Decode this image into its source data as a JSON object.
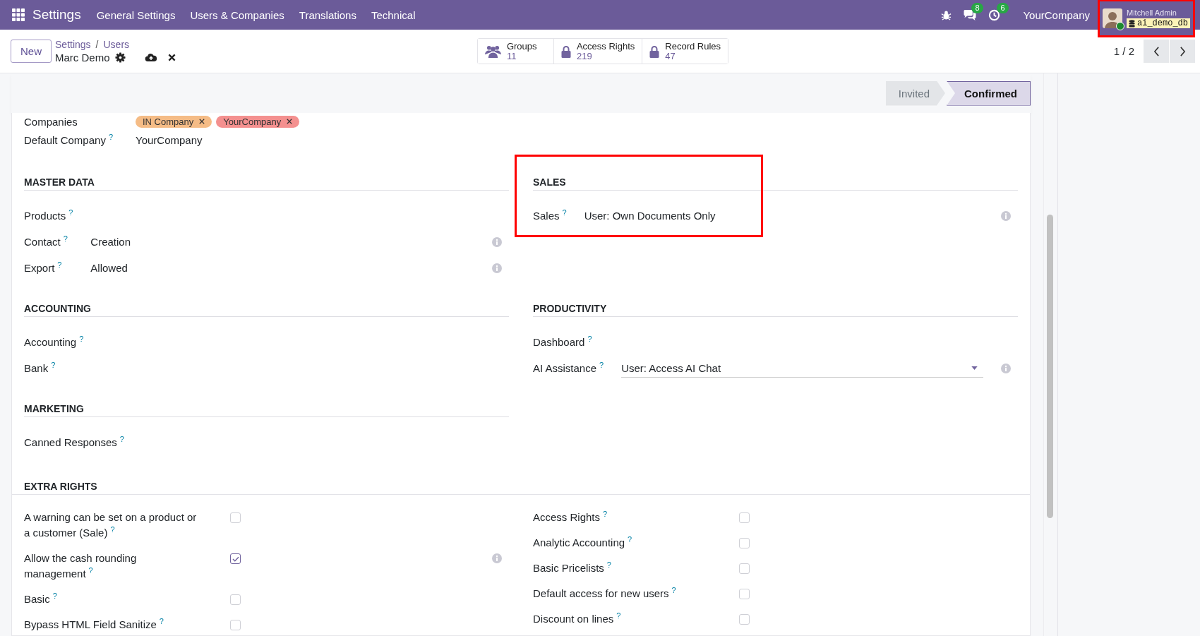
{
  "navbar": {
    "app_title": "Settings",
    "menu": [
      "General Settings",
      "Users & Companies",
      "Translations",
      "Technical"
    ],
    "messages_count": "8",
    "activities_count": "6",
    "company": "YourCompany",
    "user": {
      "name": "Mitchell Admin",
      "database": "ai_demo_db",
      "highlighted": true
    }
  },
  "control_panel": {
    "new_button": "New",
    "breadcrumbs": [
      "Settings",
      "Users"
    ],
    "breadcrumb_separator": "/",
    "record_title": "Marc Demo",
    "pager": "1 / 2",
    "smart_buttons": [
      {
        "kind": "groups",
        "label": "Groups",
        "count": "11"
      },
      {
        "kind": "lock",
        "label": "Access Rights",
        "count": "219"
      },
      {
        "kind": "lock",
        "label": "Record Rules",
        "count": "47"
      }
    ]
  },
  "status_bar": {
    "stages": [
      {
        "label": "Invited",
        "selected": false
      },
      {
        "label": "Confirmed",
        "selected": true
      }
    ]
  },
  "companies": {
    "label": "Companies",
    "tags": [
      {
        "label": "IN Company",
        "color": "#f5bc86"
      },
      {
        "label": "YourCompany",
        "color": "#f4908f"
      }
    ]
  },
  "default_company": {
    "label": "Default Company",
    "help": "?",
    "value": "YourCompany"
  },
  "section_rows": [
    [
      {
        "title": "MASTER DATA",
        "highlighted": false,
        "fields": [
          {
            "label": "Products",
            "help": "?",
            "kind": "empty",
            "info": false
          },
          {
            "label": "Contact",
            "help": "?",
            "kind": "text",
            "value": "Creation",
            "info": true
          },
          {
            "label": "Export",
            "help": "?",
            "kind": "text",
            "value": "Allowed",
            "info": true
          }
        ]
      },
      {
        "title": "SALES",
        "highlighted": true,
        "fields": [
          {
            "label": "Sales",
            "help": "?",
            "kind": "text",
            "value": "User: Own Documents Only",
            "info": true
          }
        ]
      }
    ],
    [
      {
        "title": "ACCOUNTING",
        "highlighted": false,
        "fields": [
          {
            "label": "Accounting",
            "help": "?",
            "kind": "empty",
            "info": false
          },
          {
            "label": "Bank",
            "help": "?",
            "kind": "empty",
            "info": false
          }
        ]
      },
      {
        "title": "PRODUCTIVITY",
        "highlighted": false,
        "fields": [
          {
            "label": "Dashboard",
            "help": "?",
            "kind": "empty",
            "info": false
          },
          {
            "label": "AI Assistance",
            "help": "?",
            "kind": "select",
            "value": "User: Access AI Chat",
            "info": true
          }
        ]
      }
    ],
    [
      {
        "title": "MARKETING",
        "highlighted": false,
        "fields": [
          {
            "label": "Canned Responses",
            "help": "?",
            "kind": "empty",
            "info": false
          }
        ]
      }
    ]
  ],
  "extra_rights": {
    "title": "EXTRA RIGHTS",
    "columns": [
      [
        {
          "label": "A warning can be set on a product or a customer (Sale)",
          "help": "?",
          "checked": false,
          "info": false
        },
        {
          "label": "Allow the cash rounding management",
          "help": "?",
          "checked": true,
          "info": true
        },
        {
          "label": "Basic",
          "help": "?",
          "checked": false,
          "info": false
        },
        {
          "label": "Bypass HTML Field Sanitize",
          "help": "?",
          "checked": false,
          "info": false
        }
      ],
      [
        {
          "label": "Access Rights",
          "help": "?",
          "checked": false,
          "info": false
        },
        {
          "label": "Analytic Accounting",
          "help": "?",
          "checked": false,
          "info": false
        },
        {
          "label": "Basic Pricelists",
          "help": "?",
          "checked": false,
          "info": false
        },
        {
          "label": "Default access for new users",
          "help": "?",
          "checked": false,
          "info": false
        },
        {
          "label": "Discount on lines",
          "help": "?",
          "checked": false,
          "info": false
        }
      ]
    ]
  }
}
